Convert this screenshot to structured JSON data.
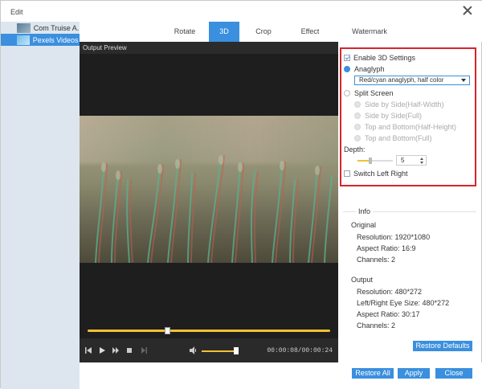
{
  "window": {
    "title": "Edit"
  },
  "files": [
    {
      "name": "Com Truise A...",
      "selected": false
    },
    {
      "name": "Pexels Videos ...",
      "selected": true
    }
  ],
  "tabs": [
    "Rotate",
    "3D",
    "Crop",
    "Effect",
    "Watermark"
  ],
  "active_tab": "3D",
  "preview": {
    "heading": "Output Preview",
    "timecode": "00:00:08/00:00:24",
    "seek_progress": 0.33,
    "volume": 0.9
  },
  "settings": {
    "enable_3d_label": "Enable 3D Settings",
    "enable_3d_checked": true,
    "anaglyph_label": "Anaglyph",
    "anaglyph_selected": "Red/cyan anaglyph, half color",
    "split_screen_label": "Split Screen",
    "split_options": [
      "Side by Side(Half-Width)",
      "Side by Side(Full)",
      "Top and Bottom(Half-Height)",
      "Top and Bottom(Full)"
    ],
    "depth_label": "Depth:",
    "depth_value": "5",
    "switch_label": "Switch Left Right",
    "switch_checked": false
  },
  "info": {
    "title": "Info",
    "original_label": "Original",
    "original": {
      "resolution": "Resolution: 1920*1080",
      "aspect": "Aspect Ratio: 16:9",
      "channels": "Channels: 2"
    },
    "output_label": "Output",
    "output": {
      "resolution": "Resolution: 480*272",
      "eye_size": "Left/Right Eye Size: 480*272",
      "aspect": "Aspect Ratio: 30:17",
      "channels": "Channels: 2"
    }
  },
  "buttons": {
    "restore_defaults": "Restore Defaults",
    "restore_all": "Restore All",
    "apply": "Apply",
    "close": "Close"
  },
  "colors": {
    "accent": "#3a8fde",
    "highlight_box": "#d9242b",
    "slider": "#f1c232"
  }
}
